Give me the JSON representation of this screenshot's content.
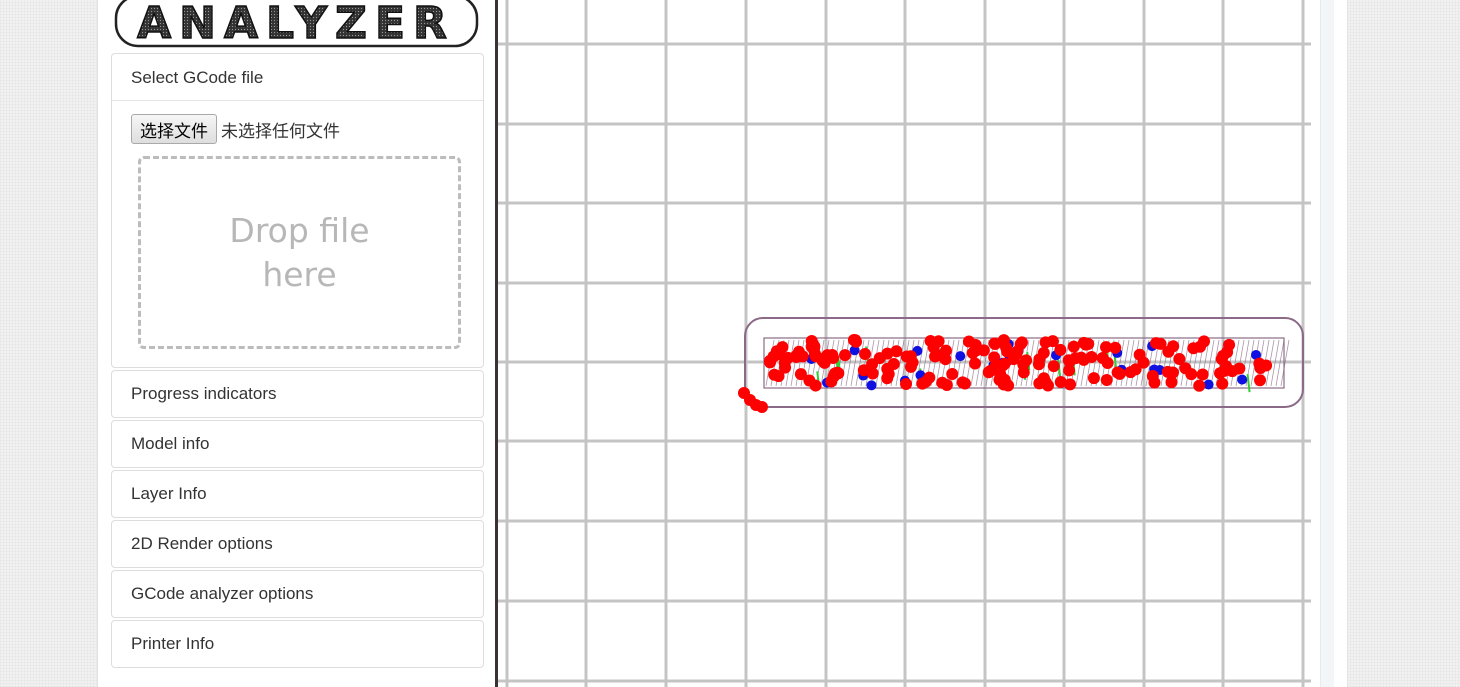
{
  "app": {
    "logo_text": "ANALYZER"
  },
  "select_gcode": {
    "heading": "Select GCode file",
    "file_button_label": "选择文件",
    "file_status": "未选择任何文件",
    "drop_text": "Drop file here"
  },
  "sections": [
    {
      "label": "Progress indicators"
    },
    {
      "label": "Model info"
    },
    {
      "label": "Layer Info"
    },
    {
      "label": "2D Render options"
    },
    {
      "label": "GCode analyzer options"
    },
    {
      "label": "Printer Info"
    }
  ],
  "colors": {
    "grid_line": "#c4c4c4",
    "model_outline": "#8a6a86",
    "extrusion_retract": "#ff0000",
    "extrusion_restart": "#1010e0",
    "move_line": "#33cc33",
    "divider": "#3a3035"
  },
  "icons": {
    "logo": "analyzer-logo"
  }
}
